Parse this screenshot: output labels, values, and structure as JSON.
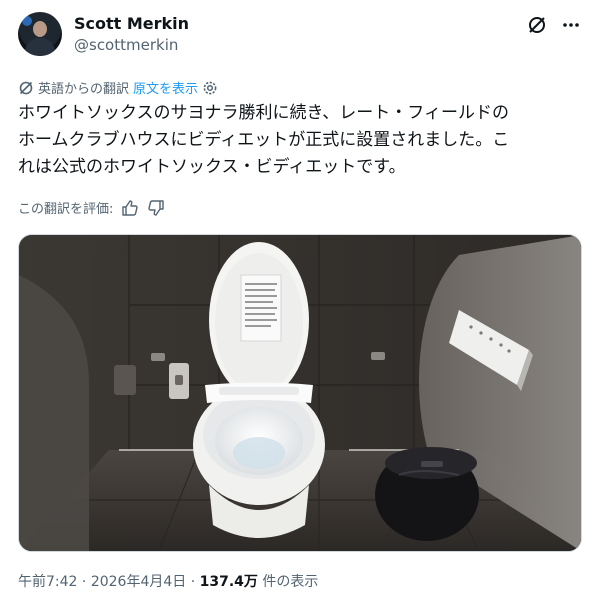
{
  "author": {
    "name": "Scott Merkin",
    "handle": "@scottmerkin"
  },
  "header_icons": [
    "grok-icon",
    "more-icon"
  ],
  "translation": {
    "label": "英語からの翻訳",
    "show_original": "原文を表示"
  },
  "tweet_text": "ホワイトソックスのサヨナラ勝利に続き、レート・フィールドの\nホームクラブハウスにビディエットが正式に設置されました。こ\nれは公式のホワイトソックス・ビディエットです。",
  "rate": {
    "label": "この翻訳を評価:"
  },
  "meta": {
    "time": "午前7:42",
    "sep1": "·",
    "date": "2026年4月4日",
    "sep2": "·",
    "views": "137.4万",
    "views_suffix": "件の表示"
  },
  "colors": {
    "link": "#1d9bf0",
    "secondary_text": "#536471",
    "primary_text": "#0f1419"
  }
}
